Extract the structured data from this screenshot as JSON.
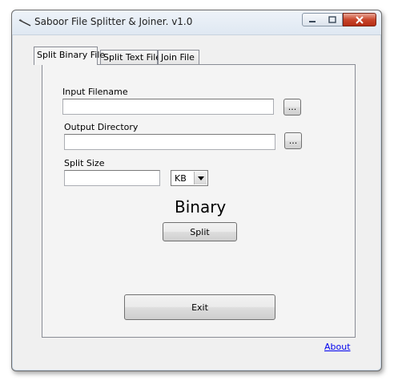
{
  "window": {
    "title": "Saboor File Splitter & Joiner. v1.0"
  },
  "tabs": [
    {
      "label": "Split Binary File",
      "active": true
    },
    {
      "label": "Split Text File",
      "active": false
    },
    {
      "label": "Join File",
      "active": false
    }
  ],
  "form": {
    "input_filename_label": "Input Filename",
    "input_filename_value": "",
    "browse_label": "...",
    "output_directory_label": "Output Directory",
    "output_directory_value": "",
    "split_size_label": "Split Size",
    "split_size_value": "",
    "unit_selected": "KB"
  },
  "mode_title": "Binary",
  "buttons": {
    "split": "Split",
    "exit": "Exit"
  },
  "footer": {
    "about_link": "About"
  },
  "colors": {
    "close_button": "#c9462c",
    "link": "#0000ee"
  }
}
